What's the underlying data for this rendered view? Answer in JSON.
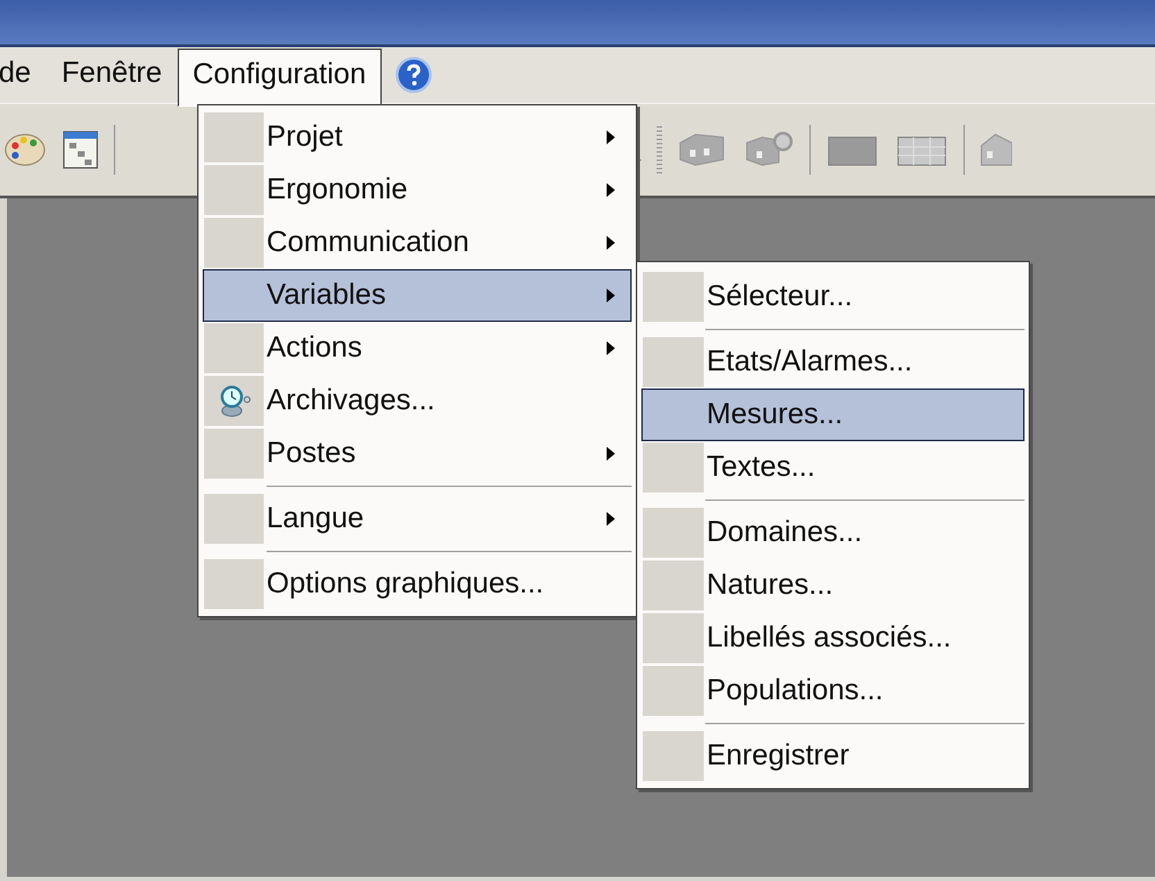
{
  "menubar": [
    {
      "label": "de",
      "selected": false
    },
    {
      "label": "Fenêtre",
      "selected": false
    },
    {
      "label": "Configuration",
      "selected": true
    }
  ],
  "menu": [
    {
      "kind": "item",
      "label": "Projet",
      "has_submenu": true,
      "selected": false,
      "has_icon": false
    },
    {
      "kind": "item",
      "label": "Ergonomie",
      "has_submenu": true,
      "selected": false,
      "has_icon": false
    },
    {
      "kind": "item",
      "label": "Communication",
      "has_submenu": true,
      "selected": false,
      "has_icon": false
    },
    {
      "kind": "item",
      "label": "Variables",
      "has_submenu": true,
      "selected": true,
      "has_icon": false
    },
    {
      "kind": "item",
      "label": "Actions",
      "has_submenu": true,
      "selected": false,
      "has_icon": false
    },
    {
      "kind": "item",
      "label": "Archivages...",
      "has_submenu": false,
      "selected": false,
      "has_icon": true
    },
    {
      "kind": "item",
      "label": "Postes",
      "has_submenu": true,
      "selected": false,
      "has_icon": false
    },
    {
      "kind": "separator"
    },
    {
      "kind": "item",
      "label": "Langue",
      "has_submenu": true,
      "selected": false,
      "has_icon": false
    },
    {
      "kind": "separator"
    },
    {
      "kind": "item",
      "label": "Options graphiques...",
      "has_submenu": false,
      "selected": false,
      "has_icon": false
    }
  ],
  "submenu": [
    {
      "kind": "item",
      "label": "Sélecteur...",
      "selected": false
    },
    {
      "kind": "separator"
    },
    {
      "kind": "item",
      "label": "Etats/Alarmes...",
      "selected": false
    },
    {
      "kind": "item",
      "label": "Mesures...",
      "selected": true
    },
    {
      "kind": "item",
      "label": "Textes...",
      "selected": false
    },
    {
      "kind": "separator"
    },
    {
      "kind": "item",
      "label": "Domaines...",
      "selected": false
    },
    {
      "kind": "item",
      "label": "Natures...",
      "selected": false
    },
    {
      "kind": "item",
      "label": "Libellés associés...",
      "selected": false
    },
    {
      "kind": "item",
      "label": "Populations...",
      "selected": false
    },
    {
      "kind": "separator"
    },
    {
      "kind": "item",
      "label": "Enregistrer",
      "selected": false
    }
  ]
}
